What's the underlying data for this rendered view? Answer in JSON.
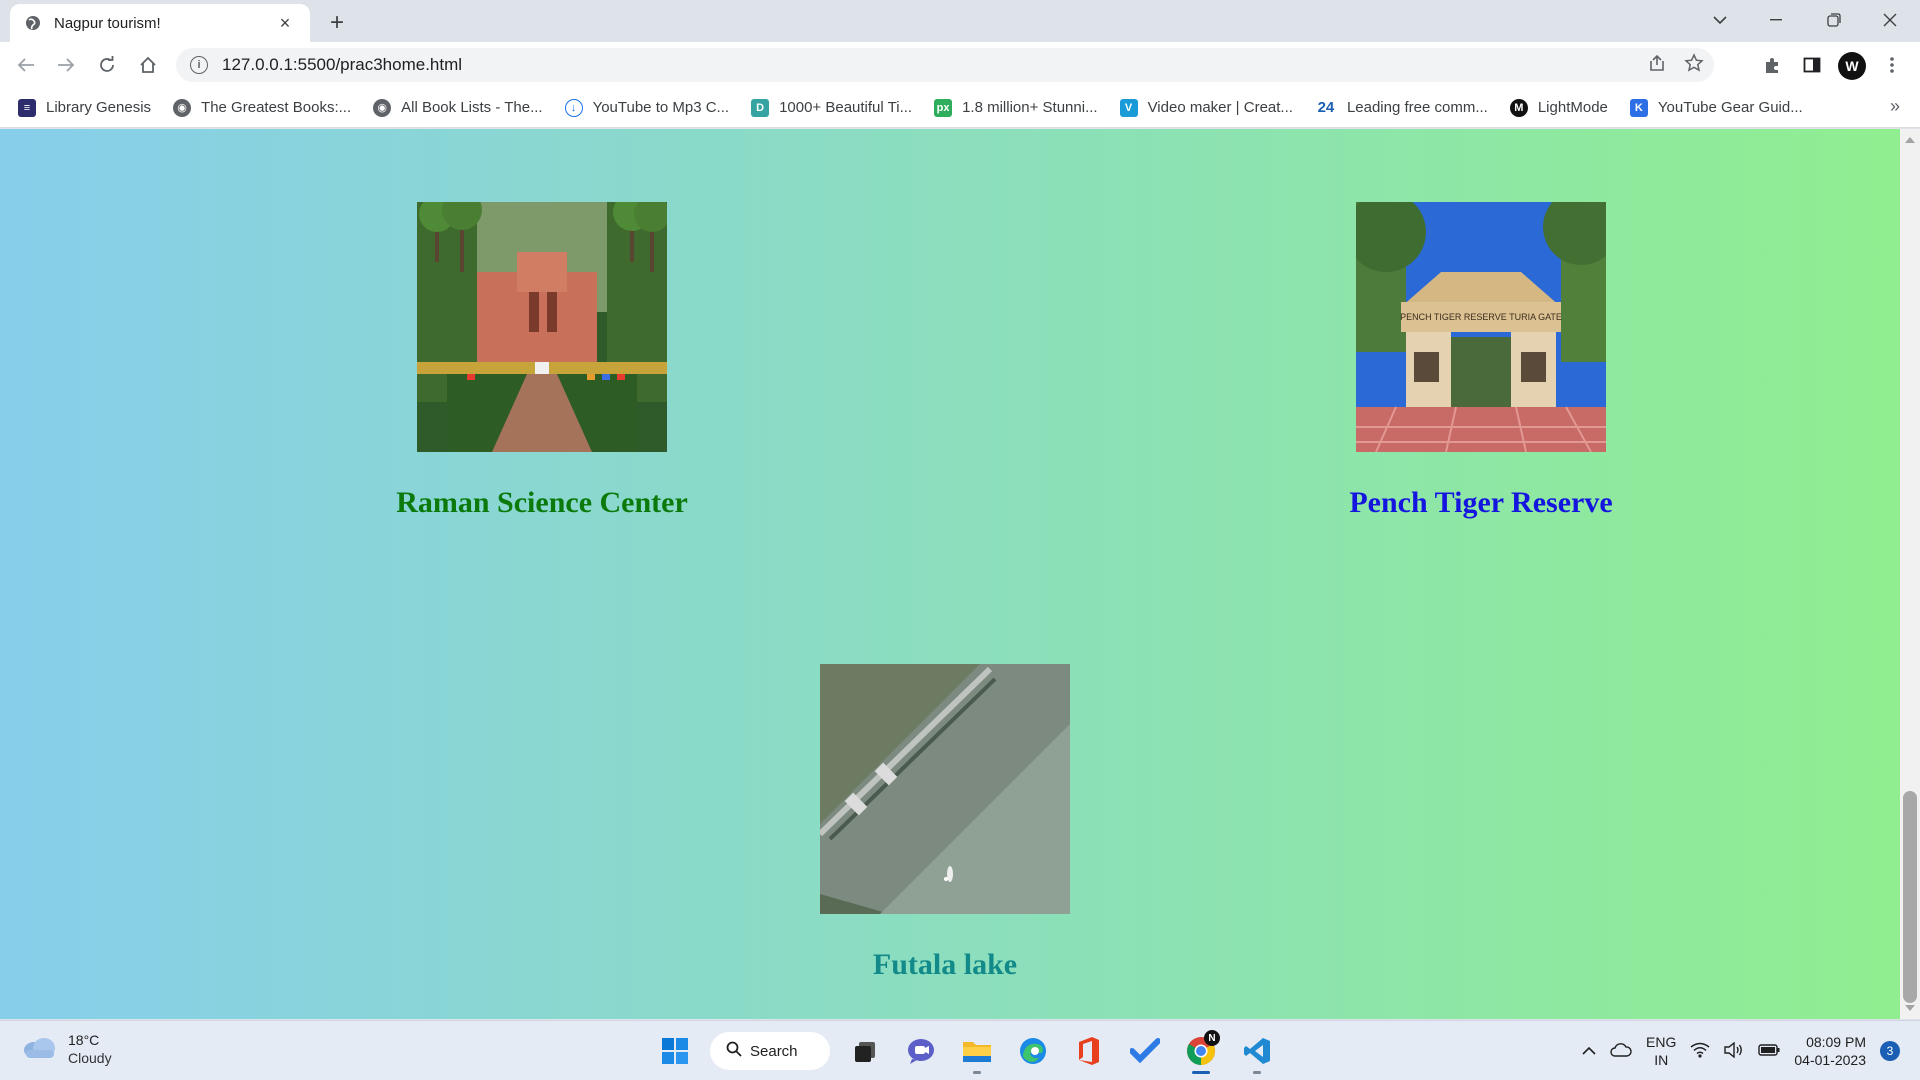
{
  "browser": {
    "tab_title": "Nagpur tourism!",
    "new_tab": "+",
    "close_tab": "×",
    "url": "127.0.0.1:5500/prac3home.html",
    "profile_initial": "W"
  },
  "bookmarks": [
    {
      "label": "Library Genesis",
      "icon": "library-icon",
      "color": "#2d2d6e"
    },
    {
      "label": "The Greatest Books:...",
      "icon": "globe-icon",
      "color": "#5f6368"
    },
    {
      "label": "All Book Lists - The...",
      "icon": "globe-icon",
      "color": "#5f6368"
    },
    {
      "label": "YouTube to Mp3 C...",
      "icon": "cloud-download-icon",
      "color": "#1a73e8"
    },
    {
      "label": "1000+ Beautiful Ti...",
      "icon": "d-logo-icon",
      "color": "#36a3a3"
    },
    {
      "label": "1.8 million+ Stunni...",
      "icon": "px-logo-icon",
      "color": "#2eae5c"
    },
    {
      "label": "Video maker | Creat...",
      "icon": "v-logo-icon",
      "color": "#1a9bd7"
    },
    {
      "label": "Leading free comm...",
      "icon": "24-logo-icon",
      "color": "#1a5fb4"
    },
    {
      "label": "LightMode",
      "icon": "lightmode-icon",
      "color": "#111111"
    },
    {
      "label": "YouTube Gear Guid...",
      "icon": "k-logo-icon",
      "color": "#2f6fe6"
    }
  ],
  "bookmarks_more": "»",
  "page": {
    "places": [
      {
        "name": "Raman Science Center",
        "color": "#0b7a0b"
      },
      {
        "name": "Pench Tiger Reserve",
        "color": "#1515e0"
      },
      {
        "name": "Futala lake",
        "color": "#138a8a"
      }
    ],
    "gate_sign": "PENCH TIGER RESERVE TURIA GATE"
  },
  "taskbar": {
    "temperature": "18°C",
    "condition": "Cloudy",
    "search_label": "Search",
    "lang_line1": "ENG",
    "lang_line2": "IN",
    "time": "08:09 PM",
    "date": "04-01-2023",
    "notifications": "3",
    "chrome_badge": "N"
  }
}
